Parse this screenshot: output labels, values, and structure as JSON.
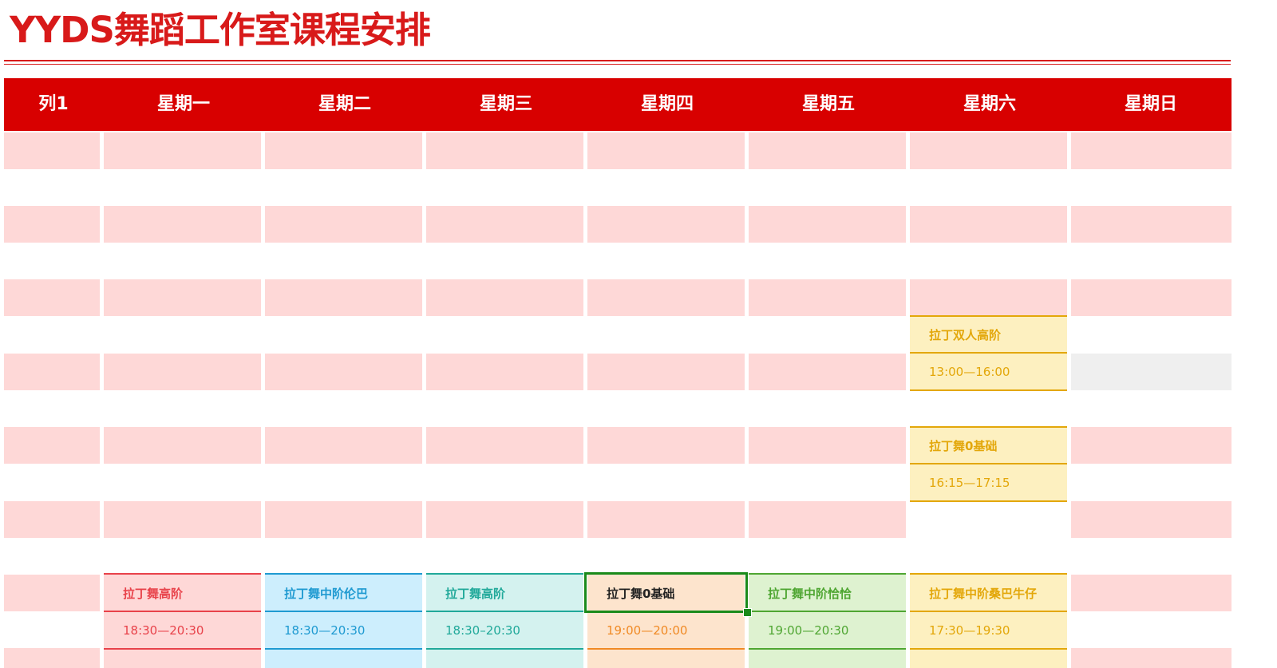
{
  "title": "YYDS舞蹈工作室课程安排",
  "colors": {
    "brand_red": "#d80000",
    "row_pink": "#fed8d7",
    "gray_cell": "#efefef"
  },
  "header": [
    "列1",
    "星期一",
    "星期二",
    "星期三",
    "星期四",
    "星期五",
    "星期六",
    "星期日"
  ],
  "saturday_courses": [
    {
      "name": "拉丁双人高阶",
      "time": "13:00—16:00"
    },
    {
      "name": "拉丁舞0基础",
      "time": "16:15—17:15"
    }
  ],
  "evening_courses": [
    {
      "day": "星期一",
      "name": "拉丁舞高阶",
      "time": "18:30—20:30",
      "color": "#e8424a",
      "bg": "#fed8d7"
    },
    {
      "day": "星期二",
      "name": "拉丁舞中阶伦巴",
      "time": "18:30—20:30",
      "color": "#1f9ad1",
      "bg": "#cdeefd"
    },
    {
      "day": "星期三",
      "name": "拉丁舞高阶",
      "time": "18:30–20:30",
      "color": "#21a99a",
      "bg": "#d4f2ef"
    },
    {
      "day": "星期四",
      "name": "拉丁舞0基础",
      "time": "19:00—20:00",
      "color": "#f08a25",
      "bg": "#fde4cd"
    },
    {
      "day": "星期五",
      "name": "拉丁舞中阶恰恰",
      "time": "19:00—20:30",
      "color": "#4fa632",
      "bg": "#def2d0"
    },
    {
      "day": "星期六",
      "name": "拉丁舞中阶桑巴牛仔",
      "time": "17:30—19:30",
      "color": "#e3a70a",
      "bg": "#fdf0c0"
    }
  ]
}
